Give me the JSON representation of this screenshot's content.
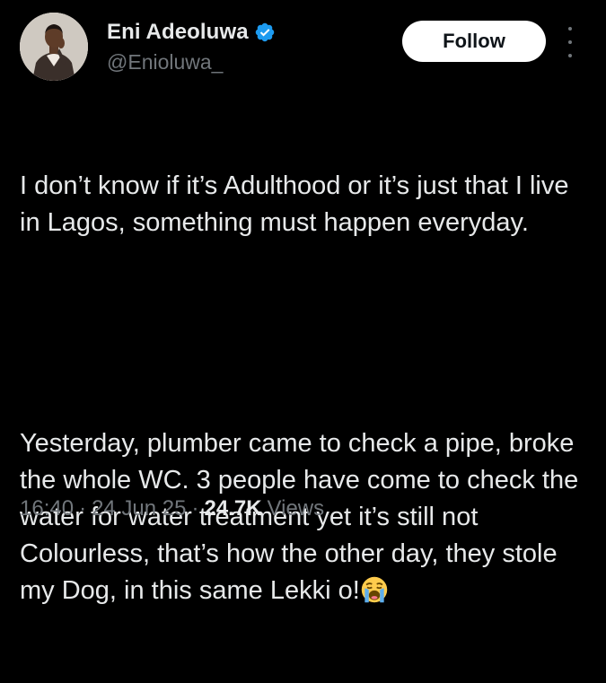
{
  "author": {
    "display_name": "Eni Adeoluwa",
    "handle": "@Enioluwa_",
    "verified": true,
    "avatar_icon": "user-avatar-photo"
  },
  "follow_label": "Follow",
  "tweet": {
    "paragraph_1": "I don’t know if it’s Adulthood or it’s just that I live in Lagos, something must happen everyday.",
    "paragraph_2_text": "Yesterday, plumber came to check a pipe, broke the whole WC. 3 people have come to check the water for water treatment yet it’s still not Colourless, that’s how the other day, they stole my Dog, in this same Lekki o!",
    "paragraph_2_emoji": "loudly-crying-face-emoji"
  },
  "meta": {
    "time": "16:40",
    "separator": "·",
    "date": "24 Jun 25",
    "views_count": "24.7K",
    "views_label": "Views"
  },
  "colors": {
    "background": "#000000",
    "text_primary": "#e7e9ea",
    "text_secondary": "#71767b",
    "verified_badge": "#1d9bf0",
    "follow_button_bg": "#ffffff"
  }
}
